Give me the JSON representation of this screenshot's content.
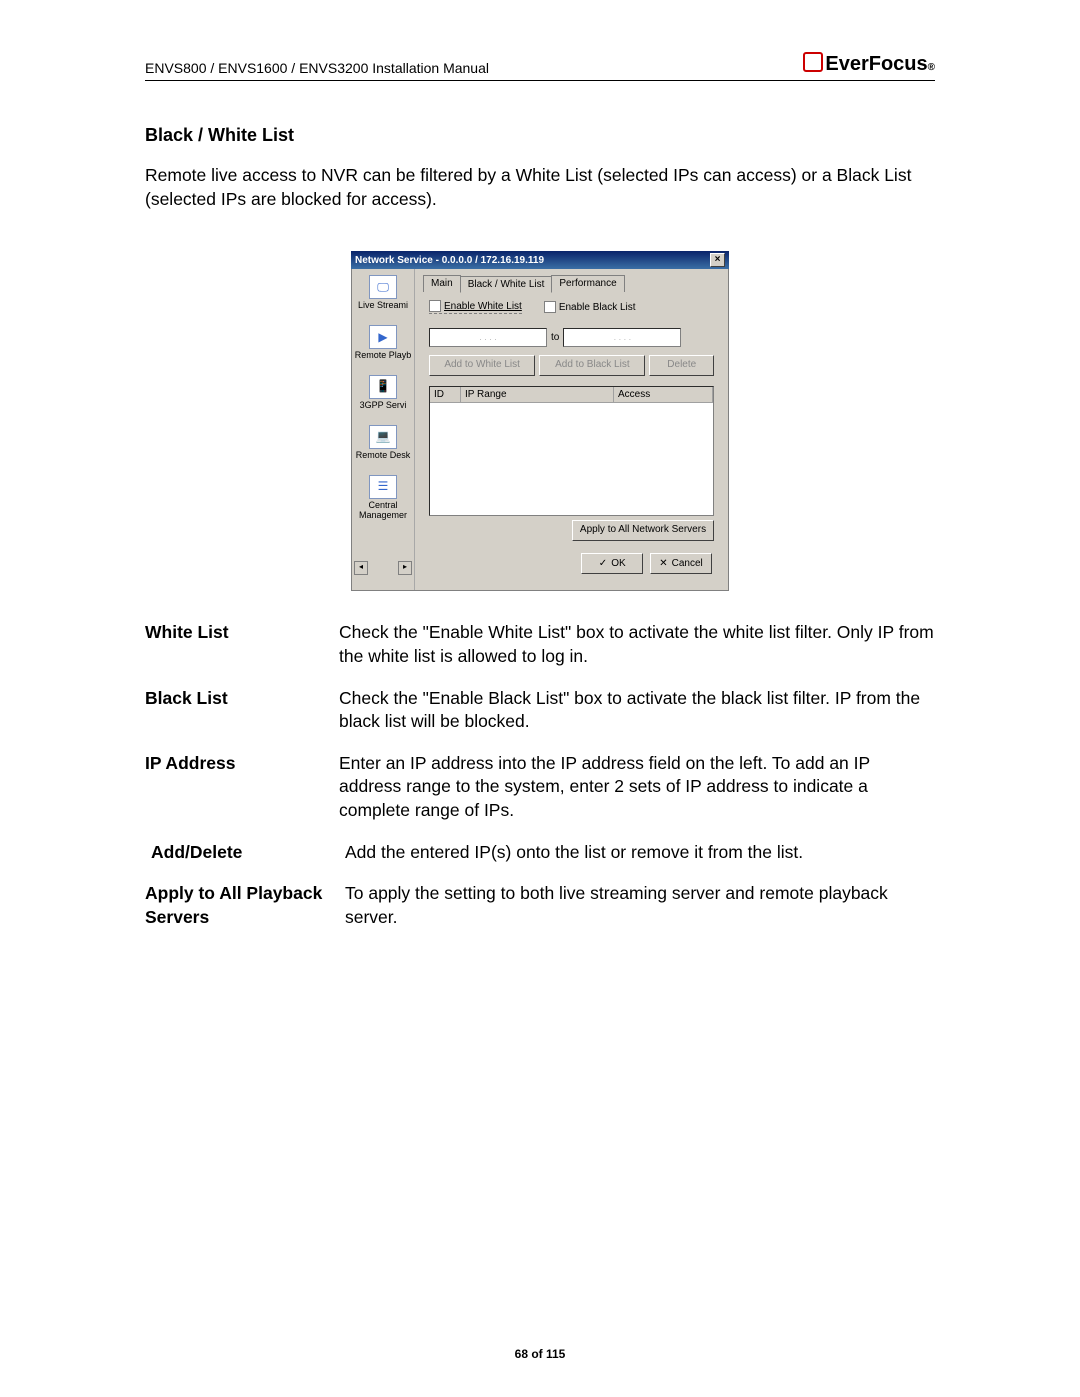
{
  "header": {
    "doc_title": "ENVS800 / ENVS1600 / ENVS3200 Installation Manual",
    "brand": "EverFocus",
    "brand_reg": "®"
  },
  "page": {
    "section_title": "Black / White List",
    "intro": "Remote live access to NVR can be filtered by a White List (selected IPs can access) or a Black List (selected IPs are blocked for access).",
    "footer": "68 of 115"
  },
  "dialog": {
    "title": "Network Service - 0.0.0.0 / 172.16.19.119",
    "sidebar": {
      "items": [
        {
          "label": "Live Streami",
          "glyph": "🖵"
        },
        {
          "label": "Remote Playb",
          "glyph": "▶"
        },
        {
          "label": "3GPP Servi",
          "glyph": "📱"
        },
        {
          "label": "Remote Desk",
          "glyph": "💻"
        },
        {
          "label": "Central\nManagemer",
          "glyph": "☰"
        }
      ],
      "scroll_left": "◂",
      "scroll_right": "▸"
    },
    "tabs": {
      "main": "Main",
      "bwlist": "Black / White List",
      "performance": "Performance"
    },
    "controls": {
      "enable_white": "Enable White List",
      "enable_black": "Enable Black List",
      "ip_placeholder": ".    .    .    .",
      "to": "to",
      "add_white": "Add to White List",
      "add_black": "Add to Black List",
      "delete": "Delete",
      "col_id": "ID",
      "col_range": "IP Range",
      "col_access": "Access",
      "apply_all": "Apply to All Network Servers",
      "ok": "OK",
      "cancel": "Cancel",
      "check_glyph": "✓",
      "x_glyph": "✕"
    }
  },
  "definitions": [
    {
      "term": "White List",
      "def": "Check the \"Enable White List\" box to activate the white list filter. Only IP from the white list is allowed to log in."
    },
    {
      "term": "Black List",
      "def": "Check the \"Enable Black List\" box to activate the black list filter. IP from the black list will be blocked."
    },
    {
      "term": "IP Address",
      "def": " Enter an IP address into the IP address field on the left. To add an IP address range to the system, enter 2 sets of IP address to indicate a complete range of IPs."
    },
    {
      "term": "Add/Delete",
      "def": "Add the entered IP(s) onto the list or remove it from the list.",
      "indent": true
    },
    {
      "term": "Apply to All Playback Servers",
      "def": "To apply the setting to both live streaming server and remote playback server."
    }
  ]
}
